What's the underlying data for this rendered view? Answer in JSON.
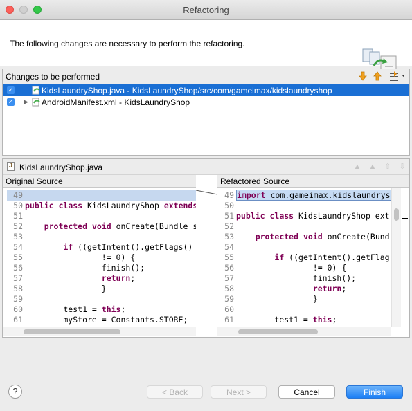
{
  "window": {
    "title": "Refactoring"
  },
  "header": {
    "message": "The following changes are necessary to perform the refactoring."
  },
  "changes": {
    "label": "Changes to be performed",
    "items": [
      {
        "text": "KidsLaundryShop.java - KidsLaundryShop/src/com/gameimax/kidslaundryshop",
        "checked": true,
        "selected": true
      },
      {
        "text": "AndroidManifest.xml - KidsLaundryShop",
        "checked": true,
        "selected": false
      }
    ]
  },
  "compare": {
    "file_name": "KidsLaundryShop.java",
    "original_title": "Original Source",
    "refactored_title": "Refactored Source",
    "original_lines": [
      {
        "n": "49",
        "code": ""
      },
      {
        "n": "50",
        "code": "public class KidsLaundryShop extends"
      },
      {
        "n": "51",
        "code": ""
      },
      {
        "n": "52",
        "code": "    protected void onCreate(Bundle s"
      },
      {
        "n": "53",
        "code": ""
      },
      {
        "n": "54",
        "code": "        if ((getIntent().getFlags()"
      },
      {
        "n": "55",
        "code": "                != 0) {"
      },
      {
        "n": "56",
        "code": "                finish();"
      },
      {
        "n": "57",
        "code": "                return;"
      },
      {
        "n": "58",
        "code": "                }"
      },
      {
        "n": "59",
        "code": ""
      },
      {
        "n": "60",
        "code": "        test1 = this;"
      },
      {
        "n": "61",
        "code": "        myStore = Constants.STORE;"
      }
    ],
    "refactored_lines": [
      {
        "n": "49",
        "code": "import com.gameimax.kidslaundrys"
      },
      {
        "n": "50",
        "code": ""
      },
      {
        "n": "51",
        "code": "public class KidsLaundryShop ext"
      },
      {
        "n": "52",
        "code": ""
      },
      {
        "n": "53",
        "code": "    protected void onCreate(Bund"
      },
      {
        "n": "54",
        "code": ""
      },
      {
        "n": "55",
        "code": "        if ((getIntent().getFlag"
      },
      {
        "n": "56",
        "code": "                != 0) {"
      },
      {
        "n": "57",
        "code": "                finish();"
      },
      {
        "n": "58",
        "code": "                return;"
      },
      {
        "n": "59",
        "code": "                }"
      },
      {
        "n": "60",
        "code": ""
      },
      {
        "n": "61",
        "code": "        test1 = this;"
      }
    ]
  },
  "buttons": {
    "help": "?",
    "back": "< Back",
    "next": "Next >",
    "cancel": "Cancel",
    "finish": "Finish"
  },
  "icons": {
    "down": "arrow-down-icon",
    "up": "arrow-up-icon",
    "filter": "filter-icon"
  }
}
